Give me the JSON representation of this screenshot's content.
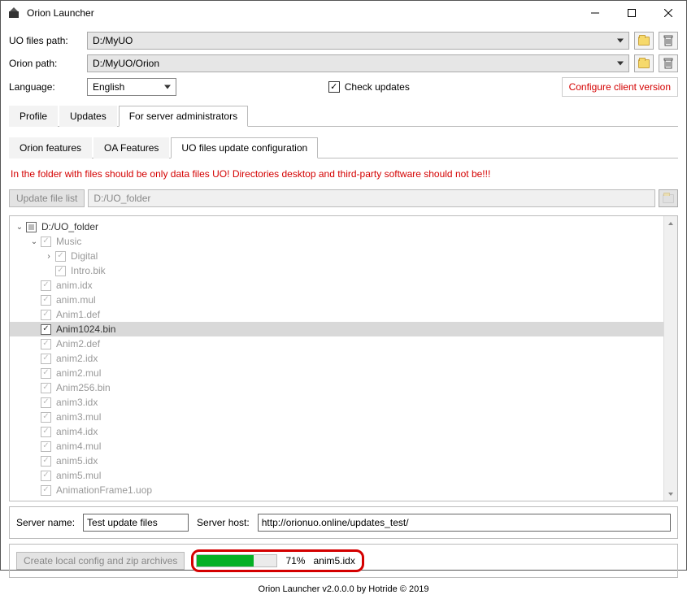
{
  "window": {
    "title": "Orion Launcher"
  },
  "paths": {
    "uo_label": "UO files path:",
    "uo_value": "D:/MyUO",
    "orion_label": "Orion path:",
    "orion_value": "D:/MyUO/Orion"
  },
  "language": {
    "label": "Language:",
    "value": "English"
  },
  "check_updates": {
    "label": "Check updates",
    "checked": true
  },
  "configure_link": "Configure client version",
  "tabs": {
    "main": [
      "Profile",
      "Updates",
      "For server administrators"
    ],
    "main_active": 2,
    "sub": [
      "Orion features",
      "OA Features",
      "UO files update configuration"
    ],
    "sub_active": 2
  },
  "warning": "In the folder with files should be only data files UO! Directories desktop and third-party software should not be!!!",
  "update_list": {
    "btn": "Update file list",
    "path": "D:/UO_folder"
  },
  "tree": {
    "root": {
      "label": "D:/UO_folder",
      "state": "mixed"
    },
    "music": {
      "label": "Music",
      "children": [
        "Digital",
        "Intro.bik"
      ]
    },
    "files": [
      "anim.idx",
      "anim.mul",
      "Anim1.def",
      "Anim1024.bin",
      "Anim2.def",
      "anim2.idx",
      "anim2.mul",
      "Anim256.bin",
      "anim3.idx",
      "anim3.mul",
      "anim4.idx",
      "anim4.mul",
      "anim5.idx",
      "anim5.mul",
      "AnimationFrame1.uop"
    ],
    "selected_index": 3
  },
  "server": {
    "name_label": "Server name:",
    "name_value": "Test update files",
    "host_label": "Server host:",
    "host_value": "http://orionuo.online/updates_test/"
  },
  "progress": {
    "btn": "Create local config and zip archives",
    "percent": 71,
    "percent_text": "71%",
    "file": "anim5.idx"
  },
  "footer": "Orion Launcher v2.0.0.0 by Hotride © 2019"
}
